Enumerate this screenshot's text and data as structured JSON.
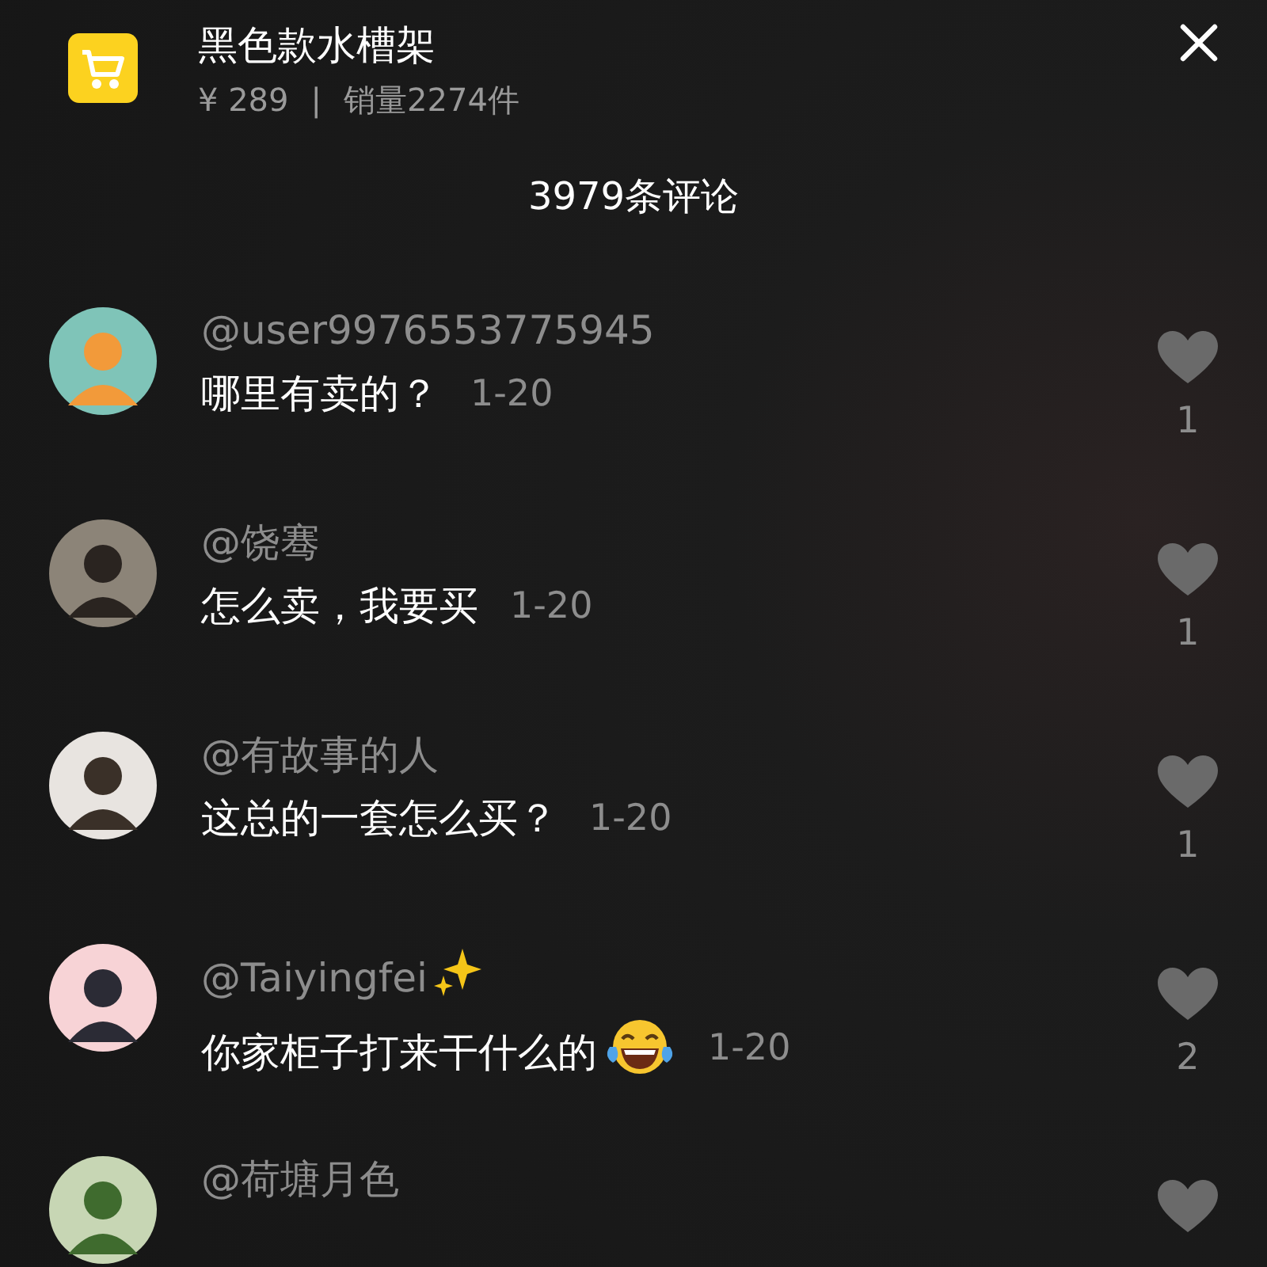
{
  "product": {
    "title": "黑色款水槽架",
    "price": "¥ 289",
    "separator": "|",
    "sales": "销量2274件"
  },
  "comment_count": "3979条评论",
  "comments": [
    {
      "username": "@user9976553775945",
      "name_icon": false,
      "text": "哪里有卖的？",
      "text_icon": false,
      "time": "1-20",
      "likes": "1"
    },
    {
      "username": "@饶骞",
      "name_icon": false,
      "text": "怎么卖，我要买",
      "text_icon": false,
      "time": "1-20",
      "likes": "1"
    },
    {
      "username": "@有故事的人",
      "name_icon": false,
      "text": "这总的一套怎么买？",
      "text_icon": false,
      "time": "1-20",
      "likes": "1"
    },
    {
      "username": "@Taiyingfei",
      "name_icon": true,
      "text": "你家柜子打来干什么的",
      "text_icon": true,
      "time": "1-20",
      "likes": "2"
    },
    {
      "username": "@荷塘月色",
      "name_icon": false
    }
  ]
}
